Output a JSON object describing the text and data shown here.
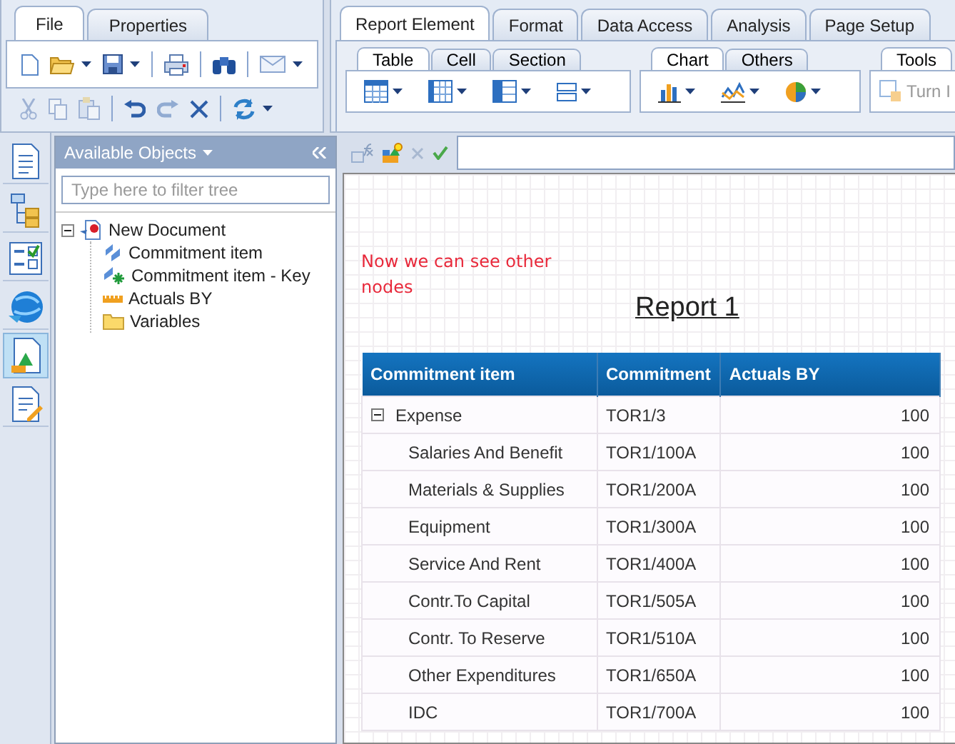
{
  "left_tabs": [
    {
      "label": "File",
      "selected": true
    },
    {
      "label": "Properties",
      "selected": false
    }
  ],
  "ribbon_tabs": [
    {
      "label": "Report Element",
      "selected": true
    },
    {
      "label": "Format",
      "selected": false
    },
    {
      "label": "Data Access",
      "selected": false
    },
    {
      "label": "Analysis",
      "selected": false
    },
    {
      "label": "Page Setup",
      "selected": false
    }
  ],
  "ribbon_groups": [
    {
      "tabs": [
        {
          "label": "Table",
          "selected": true
        },
        {
          "label": "Cell",
          "selected": false
        },
        {
          "label": "Section",
          "selected": false
        }
      ]
    },
    {
      "tabs": [
        {
          "label": "Chart",
          "selected": true
        },
        {
          "label": "Others",
          "selected": false
        }
      ]
    },
    {
      "tabs": [
        {
          "label": "Tools",
          "selected": true
        }
      ],
      "button": "Turn I"
    }
  ],
  "side_rail": [
    {
      "selected": false
    },
    {
      "selected": false
    },
    {
      "selected": false
    },
    {
      "selected": false
    },
    {
      "selected": true
    },
    {
      "selected": false
    }
  ],
  "objects_panel": {
    "title": "Available Objects",
    "filter": {
      "placeholder": "Type here to filter tree"
    },
    "tree": [
      {
        "label": "New Document",
        "kind": "document",
        "expanded": true,
        "children": [
          {
            "label": "Commitment item",
            "kind": "dimension"
          },
          {
            "label": "Commitment item - Key",
            "kind": "key"
          },
          {
            "label": "Actuals BY",
            "kind": "measure"
          },
          {
            "label": "Variables",
            "kind": "folder"
          }
        ]
      }
    ]
  },
  "report": {
    "note": "Now we can see other nodes",
    "title": "Report 1",
    "table": {
      "columns": [
        "Commitment item",
        "Commitment",
        "Actuals BY"
      ],
      "rows": [
        {
          "cells": [
            "Expense",
            "TOR1/3",
            "100"
          ],
          "expanded": true,
          "children": [
            {
              "cells": [
                "Salaries And Benefit",
                "TOR1/100A",
                "100"
              ]
            },
            {
              "cells": [
                "Materials & Supplies",
                "TOR1/200A",
                "100"
              ]
            },
            {
              "cells": [
                "Equipment",
                "TOR1/300A",
                "100"
              ]
            },
            {
              "cells": [
                "Service And Rent",
                "TOR1/400A",
                "100"
              ]
            },
            {
              "cells": [
                "Contr.To Capital",
                "TOR1/505A",
                "100"
              ]
            },
            {
              "cells": [
                "Contr. To Reserve",
                "TOR1/510A",
                "100"
              ]
            },
            {
              "cells": [
                "Other Expenditures",
                "TOR1/650A",
                "100"
              ]
            },
            {
              "cells": [
                "IDC",
                "TOR1/700A",
                "100"
              ]
            }
          ]
        }
      ]
    }
  }
}
